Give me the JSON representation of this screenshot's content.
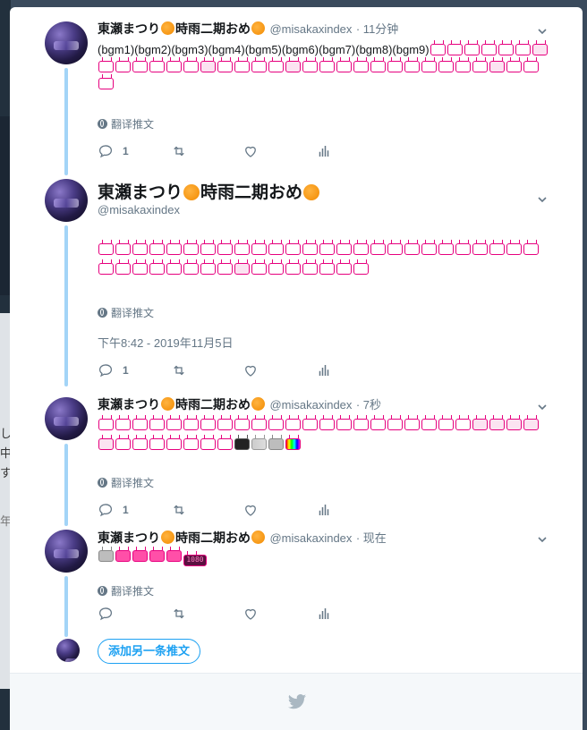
{
  "backdrop": {
    "chars": [
      "し",
      "中",
      "す",
      "年"
    ]
  },
  "tweets": [
    {
      "name": "東瀬まつり",
      "name_suffix": "時雨二期おめ",
      "handle": "@misakaxindex",
      "time": "· 11分钟",
      "text": "(bgm1)(bgm2)(bgm3)(bgm4)(bgm5)(bgm6)(bgm7)(bgm8)(bgm9)",
      "translate": "翻译推文",
      "reply_count": "1"
    },
    {
      "name": "東瀬まつり",
      "name_suffix": "時雨二期おめ",
      "handle": "@misakaxindex",
      "translate": "翻译推文",
      "timestamp": "下午8:42 - 2019年11月5日",
      "reply_count": "1"
    },
    {
      "name": "東瀬まつり",
      "name_suffix": "時雨二期おめ",
      "handle": "@misakaxindex",
      "time": "· 7秒",
      "translate": "翻译推文",
      "reply_count": "1"
    },
    {
      "name": "東瀬まつり",
      "name_suffix": "時雨二期おめ",
      "handle": "@misakaxindex",
      "time": "· 现在",
      "translate": "翻译推文",
      "emote_tag": "1080"
    }
  ],
  "add_button": "添加另一条推文",
  "icons": {
    "reply": "reply-icon",
    "retweet": "retweet-icon",
    "like": "heart-icon",
    "analytics": "analytics-icon",
    "chevron": "chevron-down-icon",
    "globe": "globe-icon",
    "bird": "twitter-bird-icon"
  },
  "colors": {
    "accent": "#1da1f2",
    "thread_line": "#a3d4f7",
    "emote_border": "#e6007e",
    "muted": "#657786"
  }
}
